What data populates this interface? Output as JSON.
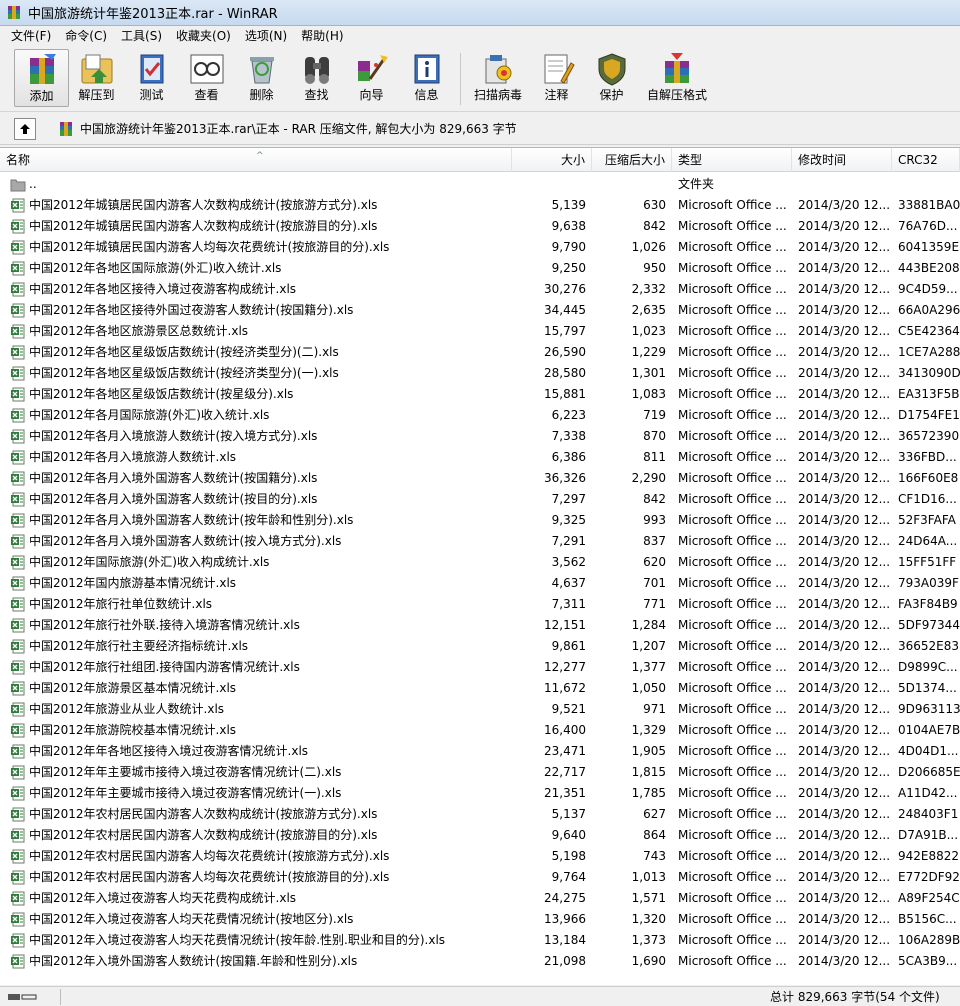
{
  "window": {
    "title": "中国旅游统计年鉴2013正本.rar - WinRAR"
  },
  "menu": [
    "文件(F)",
    "命令(C)",
    "工具(S)",
    "收藏夹(O)",
    "选项(N)",
    "帮助(H)"
  ],
  "toolbar": [
    {
      "label": "添加",
      "icon": "add-archive-icon"
    },
    {
      "label": "解压到",
      "icon": "extract-to-icon"
    },
    {
      "label": "测试",
      "icon": "test-icon"
    },
    {
      "label": "查看",
      "icon": "view-icon"
    },
    {
      "label": "删除",
      "icon": "delete-icon"
    },
    {
      "label": "查找",
      "icon": "find-icon"
    },
    {
      "label": "向导",
      "icon": "wizard-icon"
    },
    {
      "label": "信息",
      "icon": "info-icon"
    },
    {
      "label": "扫描病毒",
      "icon": "virus-scan-icon"
    },
    {
      "label": "注释",
      "icon": "comment-icon"
    },
    {
      "label": "保护",
      "icon": "protect-icon"
    },
    {
      "label": "自解压格式",
      "icon": "sfx-icon"
    }
  ],
  "address": {
    "path": "中国旅游统计年鉴2013正本.rar\\正本 - RAR 压缩文件, 解包大小为 829,663 字节"
  },
  "columns": {
    "name": "名称",
    "size": "大小",
    "packed": "压缩后大小",
    "type": "类型",
    "modified": "修改时间",
    "crc": "CRC32"
  },
  "files": [
    {
      "name": "..",
      "size": "",
      "packed": "",
      "type": "文件夹",
      "modified": "",
      "crc": "",
      "folder": true
    },
    {
      "name": "中国2012年城镇居民国内游客人次数构成统计(按旅游方式分).xls",
      "size": "5,139",
      "packed": "630",
      "type": "Microsoft Office ...",
      "modified": "2014/3/20 12...",
      "crc": "33881BA0"
    },
    {
      "name": "中国2012年城镇居民国内游客人次数构成统计(按旅游目的分).xls",
      "size": "9,638",
      "packed": "842",
      "type": "Microsoft Office ...",
      "modified": "2014/3/20 12...",
      "crc": "76A76D..."
    },
    {
      "name": "中国2012年城镇居民国内游客人均每次花费统计(按旅游目的分).xls",
      "size": "9,790",
      "packed": "1,026",
      "type": "Microsoft Office ...",
      "modified": "2014/3/20 12...",
      "crc": "6041359E"
    },
    {
      "name": "中国2012年各地区国际旅游(外汇)收入统计.xls",
      "size": "9,250",
      "packed": "950",
      "type": "Microsoft Office ...",
      "modified": "2014/3/20 12...",
      "crc": "443BE208"
    },
    {
      "name": "中国2012年各地区接待入境过夜游客构成统计.xls",
      "size": "30,276",
      "packed": "2,332",
      "type": "Microsoft Office ...",
      "modified": "2014/3/20 12...",
      "crc": "9C4D59..."
    },
    {
      "name": "中国2012年各地区接待外国过夜游客人数统计(按国籍分).xls",
      "size": "34,445",
      "packed": "2,635",
      "type": "Microsoft Office ...",
      "modified": "2014/3/20 12...",
      "crc": "66A0A296"
    },
    {
      "name": "中国2012年各地区旅游景区总数统计.xls",
      "size": "15,797",
      "packed": "1,023",
      "type": "Microsoft Office ...",
      "modified": "2014/3/20 12...",
      "crc": "C5E42364"
    },
    {
      "name": "中国2012年各地区星级饭店数统计(按经济类型分)(二).xls",
      "size": "26,590",
      "packed": "1,229",
      "type": "Microsoft Office ...",
      "modified": "2014/3/20 12...",
      "crc": "1CE7A288"
    },
    {
      "name": "中国2012年各地区星级饭店数统计(按经济类型分)(一).xls",
      "size": "28,580",
      "packed": "1,301",
      "type": "Microsoft Office ...",
      "modified": "2014/3/20 12...",
      "crc": "3413090D"
    },
    {
      "name": "中国2012年各地区星级饭店数统计(按星级分).xls",
      "size": "15,881",
      "packed": "1,083",
      "type": "Microsoft Office ...",
      "modified": "2014/3/20 12...",
      "crc": "EA313F5B"
    },
    {
      "name": "中国2012年各月国际旅游(外汇)收入统计.xls",
      "size": "6,223",
      "packed": "719",
      "type": "Microsoft Office ...",
      "modified": "2014/3/20 12...",
      "crc": "D1754FE1"
    },
    {
      "name": "中国2012年各月入境旅游人数统计(按入境方式分).xls",
      "size": "7,338",
      "packed": "870",
      "type": "Microsoft Office ...",
      "modified": "2014/3/20 12...",
      "crc": "36572390"
    },
    {
      "name": "中国2012年各月入境旅游人数统计.xls",
      "size": "6,386",
      "packed": "811",
      "type": "Microsoft Office ...",
      "modified": "2014/3/20 12...",
      "crc": "336FBD..."
    },
    {
      "name": "中国2012年各月入境外国游客人数统计(按国籍分).xls",
      "size": "36,326",
      "packed": "2,290",
      "type": "Microsoft Office ...",
      "modified": "2014/3/20 12...",
      "crc": "166F60E8"
    },
    {
      "name": "中国2012年各月入境外国游客人数统计(按目的分).xls",
      "size": "7,297",
      "packed": "842",
      "type": "Microsoft Office ...",
      "modified": "2014/3/20 12...",
      "crc": "CF1D16..."
    },
    {
      "name": "中国2012年各月入境外国游客人数统计(按年龄和性别分).xls",
      "size": "9,325",
      "packed": "993",
      "type": "Microsoft Office ...",
      "modified": "2014/3/20 12...",
      "crc": "52F3FAFA"
    },
    {
      "name": "中国2012年各月入境外国游客人数统计(按入境方式分).xls",
      "size": "7,291",
      "packed": "837",
      "type": "Microsoft Office ...",
      "modified": "2014/3/20 12...",
      "crc": "24D64A..."
    },
    {
      "name": "中国2012年国际旅游(外汇)收入构成统计.xls",
      "size": "3,562",
      "packed": "620",
      "type": "Microsoft Office ...",
      "modified": "2014/3/20 12...",
      "crc": "15FF51FF"
    },
    {
      "name": "中国2012年国内旅游基本情况统计.xls",
      "size": "4,637",
      "packed": "701",
      "type": "Microsoft Office ...",
      "modified": "2014/3/20 12...",
      "crc": "793A039F"
    },
    {
      "name": "中国2012年旅行社单位数统计.xls",
      "size": "7,311",
      "packed": "771",
      "type": "Microsoft Office ...",
      "modified": "2014/3/20 12...",
      "crc": "FA3F84B9"
    },
    {
      "name": "中国2012年旅行社外联.接待入境游客情况统计.xls",
      "size": "12,151",
      "packed": "1,284",
      "type": "Microsoft Office ...",
      "modified": "2014/3/20 12...",
      "crc": "5DF97344"
    },
    {
      "name": "中国2012年旅行社主要经济指标统计.xls",
      "size": "9,861",
      "packed": "1,207",
      "type": "Microsoft Office ...",
      "modified": "2014/3/20 12...",
      "crc": "36652E83"
    },
    {
      "name": "中国2012年旅行社组团.接待国内游客情况统计.xls",
      "size": "12,277",
      "packed": "1,377",
      "type": "Microsoft Office ...",
      "modified": "2014/3/20 12...",
      "crc": "D9899C..."
    },
    {
      "name": "中国2012年旅游景区基本情况统计.xls",
      "size": "11,672",
      "packed": "1,050",
      "type": "Microsoft Office ...",
      "modified": "2014/3/20 12...",
      "crc": "5D1374..."
    },
    {
      "name": "中国2012年旅游业从业人数统计.xls",
      "size": "9,521",
      "packed": "971",
      "type": "Microsoft Office ...",
      "modified": "2014/3/20 12...",
      "crc": "9D963113"
    },
    {
      "name": "中国2012年旅游院校基本情况统计.xls",
      "size": "16,400",
      "packed": "1,329",
      "type": "Microsoft Office ...",
      "modified": "2014/3/20 12...",
      "crc": "0104AE7B"
    },
    {
      "name": "中国2012年年各地区接待入境过夜游客情况统计.xls",
      "size": "23,471",
      "packed": "1,905",
      "type": "Microsoft Office ...",
      "modified": "2014/3/20 12...",
      "crc": "4D04D1..."
    },
    {
      "name": "中国2012年年主要城市接待入境过夜游客情况统计(二).xls",
      "size": "22,717",
      "packed": "1,815",
      "type": "Microsoft Office ...",
      "modified": "2014/3/20 12...",
      "crc": "D206685E"
    },
    {
      "name": "中国2012年年主要城市接待入境过夜游客情况统计(一).xls",
      "size": "21,351",
      "packed": "1,785",
      "type": "Microsoft Office ...",
      "modified": "2014/3/20 12...",
      "crc": "A11D42..."
    },
    {
      "name": "中国2012年农村居民国内游客人次数构成统计(按旅游方式分).xls",
      "size": "5,137",
      "packed": "627",
      "type": "Microsoft Office ...",
      "modified": "2014/3/20 12...",
      "crc": "248403F1"
    },
    {
      "name": "中国2012年农村居民国内游客人次数构成统计(按旅游目的分).xls",
      "size": "9,640",
      "packed": "864",
      "type": "Microsoft Office ...",
      "modified": "2014/3/20 12...",
      "crc": "D7A91B..."
    },
    {
      "name": "中国2012年农村居民国内游客人均每次花费统计(按旅游方式分).xls",
      "size": "5,198",
      "packed": "743",
      "type": "Microsoft Office ...",
      "modified": "2014/3/20 12...",
      "crc": "942E8822"
    },
    {
      "name": "中国2012年农村居民国内游客人均每次花费统计(按旅游目的分).xls",
      "size": "9,764",
      "packed": "1,013",
      "type": "Microsoft Office ...",
      "modified": "2014/3/20 12...",
      "crc": "E772DF92"
    },
    {
      "name": "中国2012年入境过夜游客人均天花费构成统计.xls",
      "size": "24,275",
      "packed": "1,571",
      "type": "Microsoft Office ...",
      "modified": "2014/3/20 12...",
      "crc": "A89F254C"
    },
    {
      "name": "中国2012年入境过夜游客人均天花费情况统计(按地区分).xls",
      "size": "13,966",
      "packed": "1,320",
      "type": "Microsoft Office ...",
      "modified": "2014/3/20 12...",
      "crc": "B5156C..."
    },
    {
      "name": "中国2012年入境过夜游客人均天花费情况统计(按年龄.性别.职业和目的分).xls",
      "size": "13,184",
      "packed": "1,373",
      "type": "Microsoft Office ...",
      "modified": "2014/3/20 12...",
      "crc": "106A289B"
    },
    {
      "name": "中国2012年入境外国游客人数统计(按国籍.年龄和性别分).xls",
      "size": "21,098",
      "packed": "1,690",
      "type": "Microsoft Office ...",
      "modified": "2014/3/20 12...",
      "crc": "5CA3B9..."
    }
  ],
  "status": {
    "total": "总计 829,663 字节(54 个文件)"
  }
}
